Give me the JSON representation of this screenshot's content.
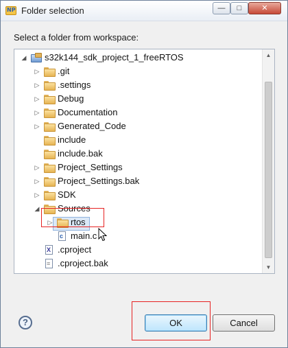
{
  "window": {
    "title": "Folder selection",
    "app_icon": "eclipse-np-icon",
    "controls": {
      "minimize": "—",
      "maximize": "□",
      "close": "✕"
    }
  },
  "prompt": "Select a folder from workspace:",
  "tree": {
    "project": {
      "label": "s32k144_sdk_project_1_freeRTOS",
      "expanded": true
    },
    "items": [
      {
        "label": ".git",
        "type": "folder",
        "expandable": true
      },
      {
        "label": ".settings",
        "type": "folder",
        "expandable": true
      },
      {
        "label": "Debug",
        "type": "folder",
        "expandable": true
      },
      {
        "label": "Documentation",
        "type": "folder",
        "expandable": true
      },
      {
        "label": "Generated_Code",
        "type": "folder",
        "expandable": true
      },
      {
        "label": "include",
        "type": "folder",
        "expandable": false
      },
      {
        "label": "include.bak",
        "type": "folder",
        "expandable": false
      },
      {
        "label": "Project_Settings",
        "type": "folder",
        "expandable": true
      },
      {
        "label": "Project_Settings.bak",
        "type": "folder",
        "expandable": true
      },
      {
        "label": "SDK",
        "type": "folder",
        "expandable": true
      },
      {
        "label": "Sources",
        "type": "folder",
        "expandable": true,
        "expanded": true
      },
      {
        "label": "rtos",
        "type": "folder",
        "expandable": true,
        "selected": true
      },
      {
        "label": "main.c",
        "type": "c-file"
      },
      {
        "label": ".cproject",
        "type": "xml-file"
      },
      {
        "label": ".cproject.bak",
        "type": "file"
      }
    ]
  },
  "buttons": {
    "ok": "OK",
    "cancel": "Cancel",
    "help": "?"
  },
  "colors": {
    "highlight": "#e62020",
    "selection": "#dbe8f7",
    "folder": "#e6b453"
  }
}
